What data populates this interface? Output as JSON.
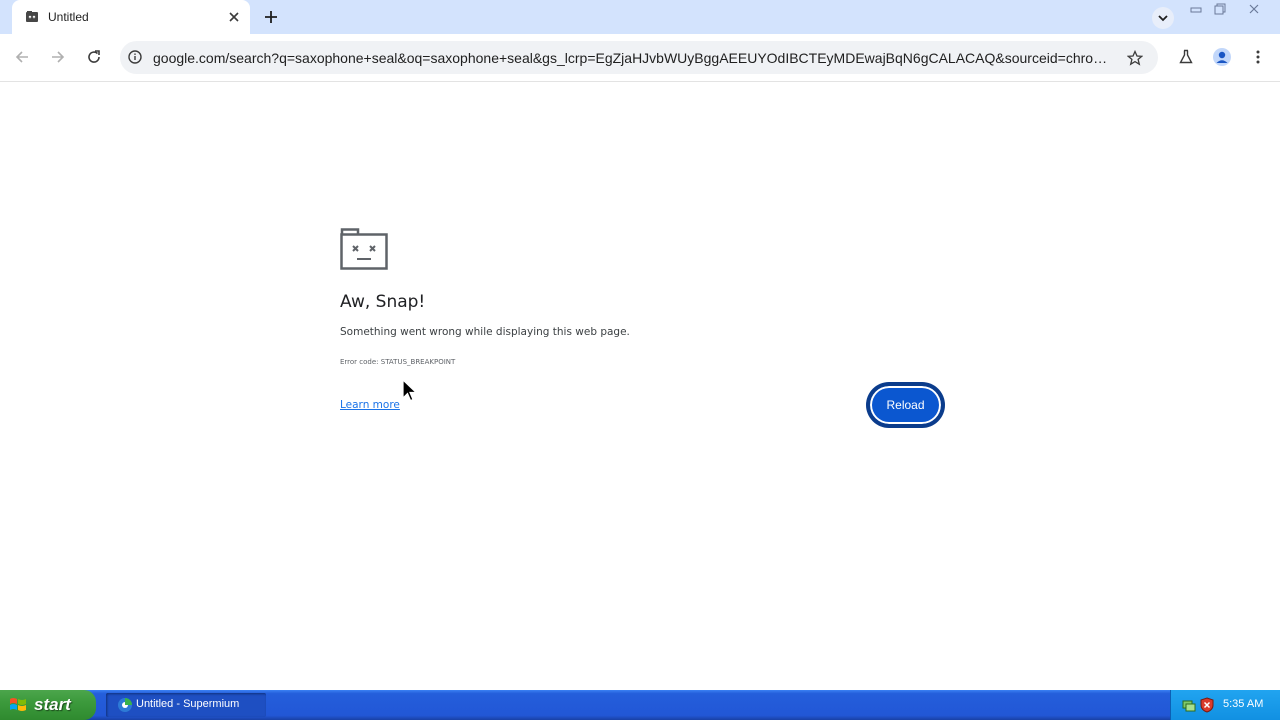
{
  "browser": {
    "tab": {
      "title": "Untitled"
    },
    "address_bar": {
      "url": "google.com/search?q=saxophone+seal&oq=saxophone+seal&gs_lcrp=EgZjaHJvbWUyBggAEEUYOdIBCTEyMDEwajBqN6gCALACAQ&sourceid=chrome&ie..."
    }
  },
  "error_page": {
    "title": "Aw, Snap!",
    "message": "Something went wrong while displaying this web page.",
    "error_code": "Error code: STATUS_BREAKPOINT",
    "learn_more": "Learn more",
    "reload_button": "Reload"
  },
  "taskbar": {
    "start_label": "start",
    "task_item": "Untitled - Supermium",
    "clock": "5:35 AM"
  },
  "colors": {
    "tabstrip_bg": "#d3e3fd",
    "accent": "#0b57d0",
    "link": "#1a73e8",
    "taskbar_blue": "#245edb",
    "start_green": "#3c9a3c"
  },
  "icons": {
    "tab_favicon": "sad-page-icon",
    "tab_close": "close-icon",
    "new_tab": "plus-icon",
    "tab_search": "chevron-down-icon",
    "back": "arrow-left-icon",
    "forward": "arrow-right-icon",
    "reload": "reload-icon",
    "site_info": "info-icon",
    "bookmark": "star-icon",
    "labs": "flask-icon",
    "profile": "person-icon",
    "menu": "kebab-menu-icon"
  }
}
